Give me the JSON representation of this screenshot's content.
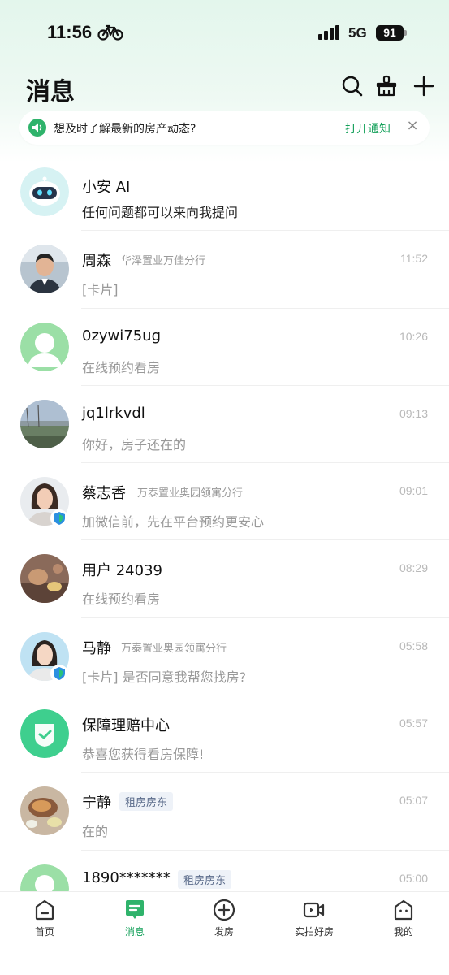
{
  "status_bar": {
    "time": "11:56",
    "network": "5G",
    "battery": "91"
  },
  "header": {
    "title": "消息"
  },
  "notify": {
    "text": "想及时了解最新的房产动态?",
    "action": "打开通知",
    "close": "×"
  },
  "colors": {
    "accent": "#14a05a",
    "muted": "#999999",
    "tag_bg": "#eef2f8"
  },
  "conversations": [
    {
      "name": "小安 AI",
      "org": "",
      "tag": "",
      "time": "",
      "preview": "任何问题都可以来向我提问",
      "avatar": "ai-robot-avatar"
    },
    {
      "name": "周森",
      "org": "华泽置业万佳分行",
      "tag": "",
      "time": "11:52",
      "preview": "[卡片]",
      "avatar": "man-photo-avatar"
    },
    {
      "name": "0zywi75ug",
      "org": "",
      "tag": "",
      "time": "10:26",
      "preview": "在线预约看房",
      "avatar": "default-user-avatar"
    },
    {
      "name": "jq1lrkvdl",
      "org": "",
      "tag": "",
      "time": "09:13",
      "preview": "你好，房子还在的",
      "avatar": "landscape-photo-avatar"
    },
    {
      "name": "蔡志香",
      "org": "万泰置业奥园领寓分行",
      "tag": "",
      "time": "09:01",
      "preview": "加微信前，先在平台预约更安心",
      "avatar": "woman-photo-avatar"
    },
    {
      "name": "用户 24039",
      "org": "",
      "tag": "",
      "time": "08:29",
      "preview": "在线预约看房",
      "avatar": "tea-photo-avatar"
    },
    {
      "name": "马静",
      "org": "万泰置业奥园领寓分行",
      "tag": "",
      "time": "05:58",
      "preview": "[卡片] 是否同意我帮您找房?",
      "avatar": "woman-photo-avatar"
    },
    {
      "name": "保障理赔中心",
      "org": "",
      "tag": "",
      "time": "05:57",
      "preview": "恭喜您获得看房保障!",
      "avatar": "shield-check-avatar"
    },
    {
      "name": "宁静",
      "org": "",
      "tag": "租房房东",
      "time": "05:07",
      "preview": "在的",
      "avatar": "food-photo-avatar"
    },
    {
      "name": "1890*******",
      "org": "",
      "tag": "租房房东",
      "time": "05:00",
      "preview": "",
      "avatar": "default-user-avatar"
    }
  ],
  "tabs": [
    {
      "label": "首页",
      "icon": "home-icon"
    },
    {
      "label": "消息",
      "icon": "message-icon"
    },
    {
      "label": "发房",
      "icon": "plus-circle-icon"
    },
    {
      "label": "实拍好房",
      "icon": "video-camera-icon"
    },
    {
      "label": "我的",
      "icon": "profile-icon"
    }
  ]
}
